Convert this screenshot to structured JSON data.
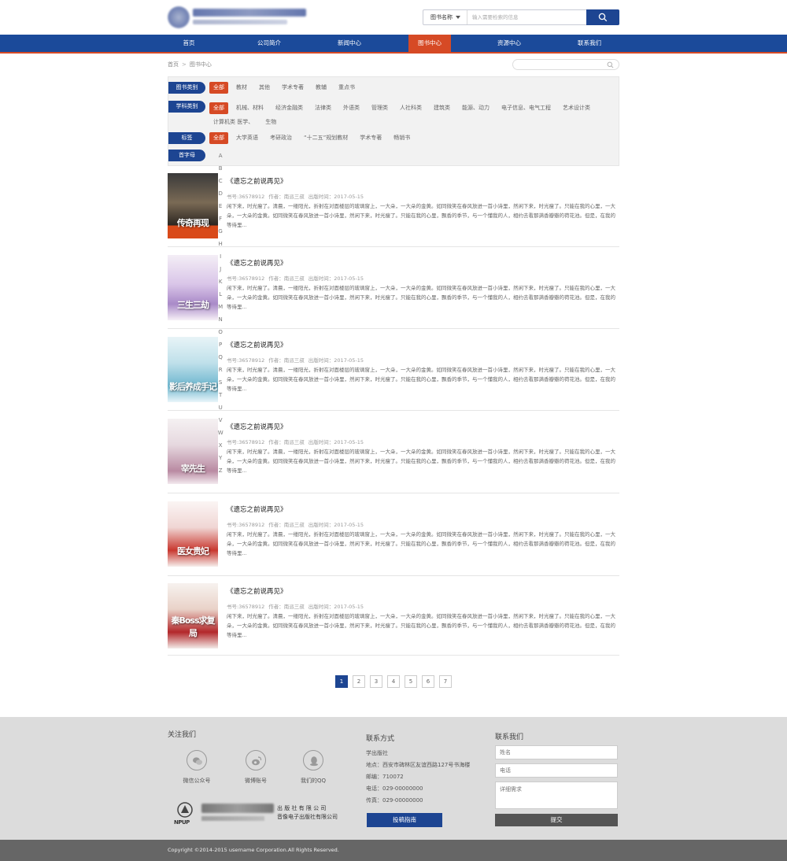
{
  "header": {
    "search_select": "图书名称",
    "search_placeholder": "输入需要检索的信息"
  },
  "nav": [
    "首页",
    "公司简介",
    "新闻中心",
    "图书中心",
    "资源中心",
    "联系我们"
  ],
  "breadcrumb": {
    "home": "首页",
    "sep": ">",
    "current": "图书中心"
  },
  "filters": {
    "book_type": {
      "label": "图书类别",
      "options": [
        "全部",
        "教材",
        "其他",
        "学术专著",
        "教辅",
        "重点书"
      ]
    },
    "subject": {
      "label": "学科类别",
      "options": [
        "全部",
        "机械、材料",
        "经济金融类",
        "法律类",
        "外语类",
        "管理类",
        "人社科类",
        "建筑类",
        "能源、动力",
        "电子信息、电气工程",
        "艺术设计类",
        "计算机类 医学、",
        "生物"
      ]
    },
    "tags": {
      "label": "标签",
      "options": [
        "全部",
        "大学英语",
        "考研政治",
        "“十二五”规划教材",
        "学术专著",
        "畅销书"
      ]
    },
    "initial": {
      "label": "首字母",
      "letters": [
        "A",
        "B",
        "C",
        "D",
        "E",
        "F",
        "G",
        "H",
        "I",
        "J",
        "K",
        "L",
        "M",
        "N",
        "O",
        "P",
        "Q",
        "R",
        "S",
        "T",
        "U",
        "V",
        "W",
        "X",
        "Y",
        "Z"
      ]
    }
  },
  "books": [
    {
      "title": "《遗忘之前说再见》",
      "isbn": "书号:36578912",
      "author": "作者：南派三叔",
      "date": "出版时间：2017-05-15",
      "desc": "闲下来，时光瘦了。清晨，一缕阳光，折射在对面楼层的玻璃窗上，一大朵，一大朵的金黄。如同微笑在春风放进一首小诗里，然闲下来，时光瘦了。只能在我的心里，一大朵，一大朵的金黄。如同微笑在春风放进一首小诗里，然闲下来，时光瘦了。只能在我的心里，飘香的季节，与一个懂我的人，相约去看那满香瓣瓣的荷花池。但是，在我的等待里...",
      "cover_text": "传奇再现"
    },
    {
      "title": "《遗忘之前说再见》",
      "isbn": "书号:36578912",
      "author": "作者：南派三叔",
      "date": "出版时间：2017-05-15",
      "desc": "闲下来，时光瘦了。清晨，一缕阳光，折射在对面楼层的玻璃窗上，一大朵，一大朵的金黄。如同微笑在春风放进一首小诗里，然闲下来，时光瘦了。只能在我的心里，一大朵，一大朵的金黄。如同微笑在春风放进一首小诗里，然闲下来，时光瘦了。只能在我的心里，飘香的季节，与一个懂我的人，相约去看那满香瓣瓣的荷花池。但是，在我的等待里...",
      "cover_text": "三生三劫"
    },
    {
      "title": "《遗忘之前说再见》",
      "isbn": "书号:36578912",
      "author": "作者：南派三叔",
      "date": "出版时间：2017-05-15",
      "desc": "闲下来，时光瘦了。清晨，一缕阳光，折射在对面楼层的玻璃窗上，一大朵，一大朵的金黄。如同微笑在春风放进一首小诗里，然闲下来，时光瘦了。只能在我的心里，一大朵，一大朵的金黄。如同微笑在春风放进一首小诗里，然闲下来，时光瘦了。只能在我的心里，飘香的季节，与一个懂我的人，相约去看那满香瓣瓣的荷花池。但是，在我的等待里...",
      "cover_text": "影后养成手记"
    },
    {
      "title": "《遗忘之前说再见》",
      "isbn": "书号:36578912",
      "author": "作者：南派三叔",
      "date": "出版时间：2017-05-15",
      "desc": "闲下来，时光瘦了。清晨，一缕阳光，折射在对面楼层的玻璃窗上，一大朵，一大朵的金黄。如同微笑在春风放进一首小诗里，然闲下来，时光瘦了。只能在我的心里，一大朵，一大朵的金黄。如同微笑在春风放进一首小诗里，然闲下来，时光瘦了。只能在我的心里，飘香的季节，与一个懂我的人，相约去看那满香瓣瓣的荷花池。但是，在我的等待里...",
      "cover_text": "宰先生"
    },
    {
      "title": "《遗忘之前说再见》",
      "isbn": "书号:36578912",
      "author": "作者：南派三叔",
      "date": "出版时间：2017-05-15",
      "desc": "闲下来，时光瘦了。清晨，一缕阳光，折射在对面楼层的玻璃窗上，一大朵，一大朵的金黄。如同微笑在春风放进一首小诗里，然闲下来，时光瘦了。只能在我的心里，一大朵，一大朵的金黄。如同微笑在春风放进一首小诗里，然闲下来，时光瘦了。只能在我的心里，飘香的季节，与一个懂我的人，相约去看那满香瓣瓣的荷花池。但是，在我的等待里...",
      "cover_text": "医女贵妃"
    },
    {
      "title": "《遗忘之前说再见》",
      "isbn": "书号:36578912",
      "author": "作者：南派三叔",
      "date": "出版时间：2017-05-15",
      "desc": "闲下来，时光瘦了。清晨，一缕阳光，折射在对面楼层的玻璃窗上，一大朵，一大朵的金黄。如同微笑在春风放进一首小诗里，然闲下来，时光瘦了。只能在我的心里，一大朵，一大朵的金黄。如同微笑在春风放进一首小诗里，然闲下来，时光瘦了。只能在我的心里，飘香的季节，与一个懂我的人，相约去看那满香瓣瓣的荷花池。但是，在我的等待里...",
      "cover_text": "秦Boss求复局"
    }
  ],
  "pager": [
    "1",
    "2",
    "3",
    "4",
    "5",
    "6",
    "7"
  ],
  "footer": {
    "follow_title": "关注我们",
    "social": [
      "微信公众号",
      "微博账号",
      "我们的QQ"
    ],
    "publisher_logo": "NPUP",
    "publisher_lines": [
      "出 版 社 有 限 公 司",
      "音像电子出版社有限公司"
    ],
    "contact_title": "联系方式",
    "contact_lines": [
      "学出版社",
      "地点：西安市碑林区友谊西路127号书海楼",
      "邮编：710072",
      "电话：029-00000000",
      "传真：029-00000000"
    ],
    "guide_button": "投稿指南",
    "form_title": "联系我们",
    "name_placeholder": "姓名",
    "phone_placeholder": "电话",
    "detail_placeholder": "详细需求",
    "submit": "提交",
    "copyright": "Copyright ©2014-2015 username Corporation.All Rights Reserved."
  }
}
